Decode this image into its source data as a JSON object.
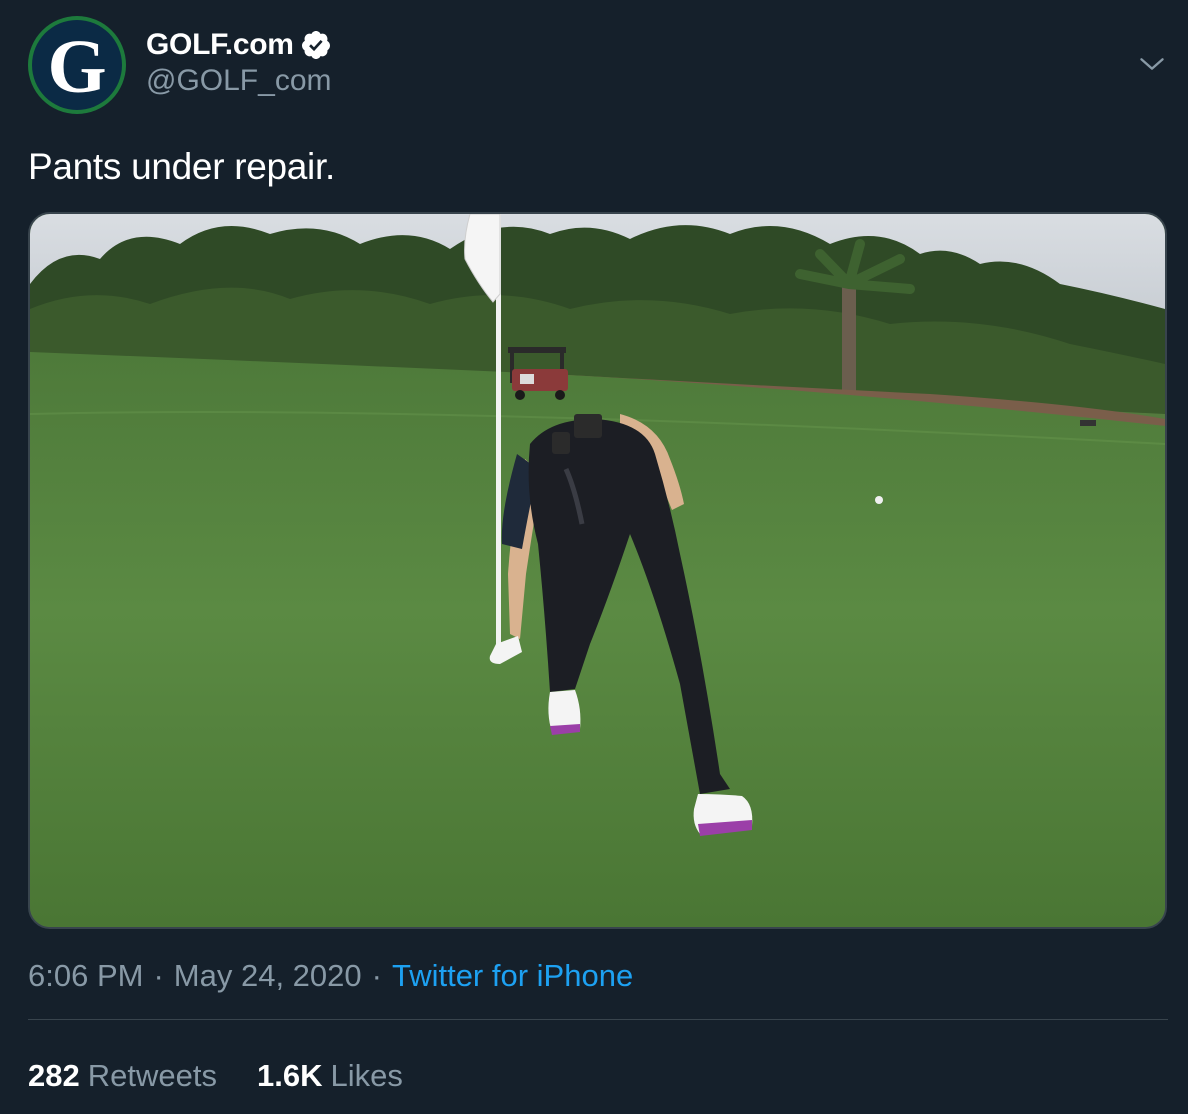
{
  "author": {
    "avatar_letter": "G",
    "display_name": "GOLF.com",
    "handle": "@GOLF_com",
    "verified": true,
    "avatar_ring_color": "#1d7a3c",
    "avatar_bg_color": "#0b2a45"
  },
  "tweet": {
    "text": "Pants under repair.",
    "media": {
      "type": "photo",
      "icons": [
        "flagstick",
        "golf-cart",
        "golfer",
        "palm-tree",
        "golf-ball"
      ]
    }
  },
  "meta": {
    "time": "6:06 PM",
    "separator": "·",
    "date": "May 24, 2020",
    "source": "Twitter for iPhone"
  },
  "stats": {
    "retweets_count": "282",
    "retweets_label": "Retweets",
    "likes_count": "1.6K",
    "likes_label": "Likes"
  },
  "colors": {
    "background": "#15202b",
    "secondary_text": "#8899a6",
    "link": "#1da1f2",
    "border": "#38444d",
    "verified_badge": "#ffffff"
  }
}
